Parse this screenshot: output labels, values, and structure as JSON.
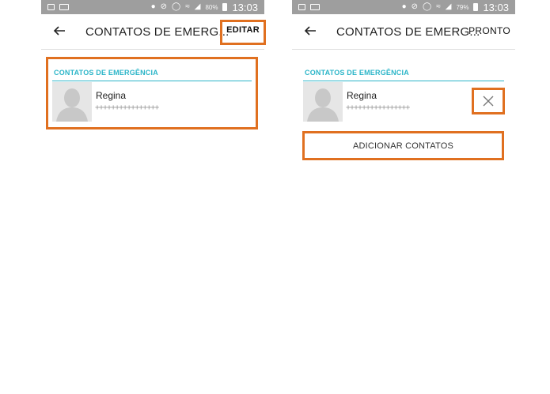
{
  "status_bar": {
    "left": {
      "time": "13:03",
      "battery": "80%"
    },
    "right": {
      "time": "13:03",
      "battery": "79%"
    }
  },
  "left_screen": {
    "title": "CONTATOS DE EMERG...",
    "action": "EDITAR",
    "section_header": "CONTATOS DE EMERGÊNCIA",
    "contact": {
      "name": "Regina",
      "phone": "++++++++++++++++"
    }
  },
  "right_screen": {
    "title": "CONTATOS DE EMERG...",
    "action": "PRONTO",
    "section_header": "CONTATOS DE EMERGÊNCIA",
    "contact": {
      "name": "Regina",
      "phone": "++++++++++++++++"
    },
    "add_button": "ADICIONAR CONTATOS"
  },
  "colors": {
    "highlight": "#e07020",
    "accent": "#2bb5c8",
    "status_bar": "#9e9e9e"
  },
  "icons": [
    "back-arrow-icon",
    "close-icon",
    "avatar-placeholder",
    "location-icon",
    "mute-icon",
    "alarm-icon",
    "wifi-icon",
    "signal-icon",
    "battery-icon",
    "gallery-icon",
    "voicemail-icon"
  ]
}
